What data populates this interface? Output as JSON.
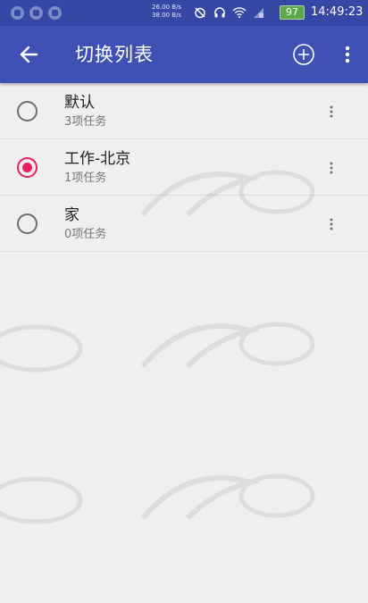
{
  "status_bar": {
    "net_speed_up": "26.00 B/s",
    "net_speed_down": "38.00 B/s",
    "battery": "97",
    "time": "14:49:23",
    "icons": [
      "notification-icon",
      "notification-icon",
      "image-icon",
      "alarm-off-icon",
      "headset-icon",
      "wifi-icon",
      "signal-icon"
    ]
  },
  "toolbar": {
    "title": "切换列表",
    "back_icon": "arrow-back-icon",
    "add_icon": "add-circle-icon",
    "more_icon": "more-vert-icon"
  },
  "lists": [
    {
      "name": "默认",
      "count": "3项任务",
      "selected": false
    },
    {
      "name": "工作-北京",
      "count": "1项任务",
      "selected": true
    },
    {
      "name": "家",
      "count": "0项任务",
      "selected": false
    }
  ],
  "colors": {
    "primary": "#3f51b5",
    "primary_dark": "#3647a6",
    "accent": "#e91e63",
    "background": "#efefef"
  }
}
